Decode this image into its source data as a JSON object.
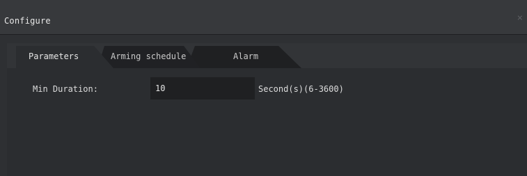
{
  "window": {
    "title": "Configure",
    "close_glyph": "×"
  },
  "tabs": [
    {
      "label": "Parameters",
      "active": true
    },
    {
      "label": "Arming schedule",
      "active": false
    },
    {
      "label": "Alarm",
      "active": false
    }
  ],
  "parameters": {
    "min_duration_label": "Min Duration:",
    "min_duration_value": "10",
    "min_duration_unit": "Second(s)(6-3600)"
  },
  "colors": {
    "background": "#2e3033",
    "titlebar": "#37393c",
    "tab_active": "#2b2d30",
    "tab_inactive": "#1f2022",
    "input_bg": "#1f2022",
    "text": "#dcdcdc"
  }
}
